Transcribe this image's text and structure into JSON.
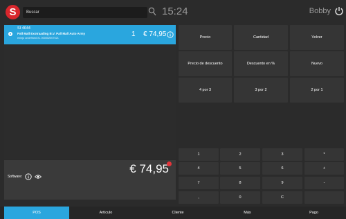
{
  "header": {
    "logo_letter": "S",
    "search_placeholder": "Buscar",
    "time": "15:24",
    "user": "Bobby",
    "brand_color": "#d9262c"
  },
  "cart": {
    "items": [
      {
        "sku": "SI 4644",
        "name": "Pall Mall Exotraading B.V. Pall Mall Auto Army",
        "description": "eninjo undefined XL 000002007021",
        "quantity": "1",
        "price": "€ 74,95"
      }
    ],
    "total": "€ 74,95",
    "software_label": "Software:",
    "accent_color": "#2aa6de"
  },
  "actions": {
    "row1": [
      "Precio",
      "Cantidad",
      "Volver"
    ],
    "row2": [
      "Precio de descuento",
      "Descuento en %",
      "Nuevo"
    ],
    "row3": [
      "4 por 3",
      "3 por 2",
      "2 por 1"
    ]
  },
  "keypad": {
    "rows": [
      [
        "1",
        "2",
        "3",
        "*"
      ],
      [
        "4",
        "5",
        "6",
        "+"
      ],
      [
        "7",
        "8",
        "9",
        "-"
      ],
      [
        ",",
        "0",
        "C",
        ""
      ]
    ]
  },
  "nav": {
    "tabs": [
      "POS",
      "Artículo",
      "Cliente",
      "Más",
      "Pago"
    ],
    "active": "POS"
  }
}
